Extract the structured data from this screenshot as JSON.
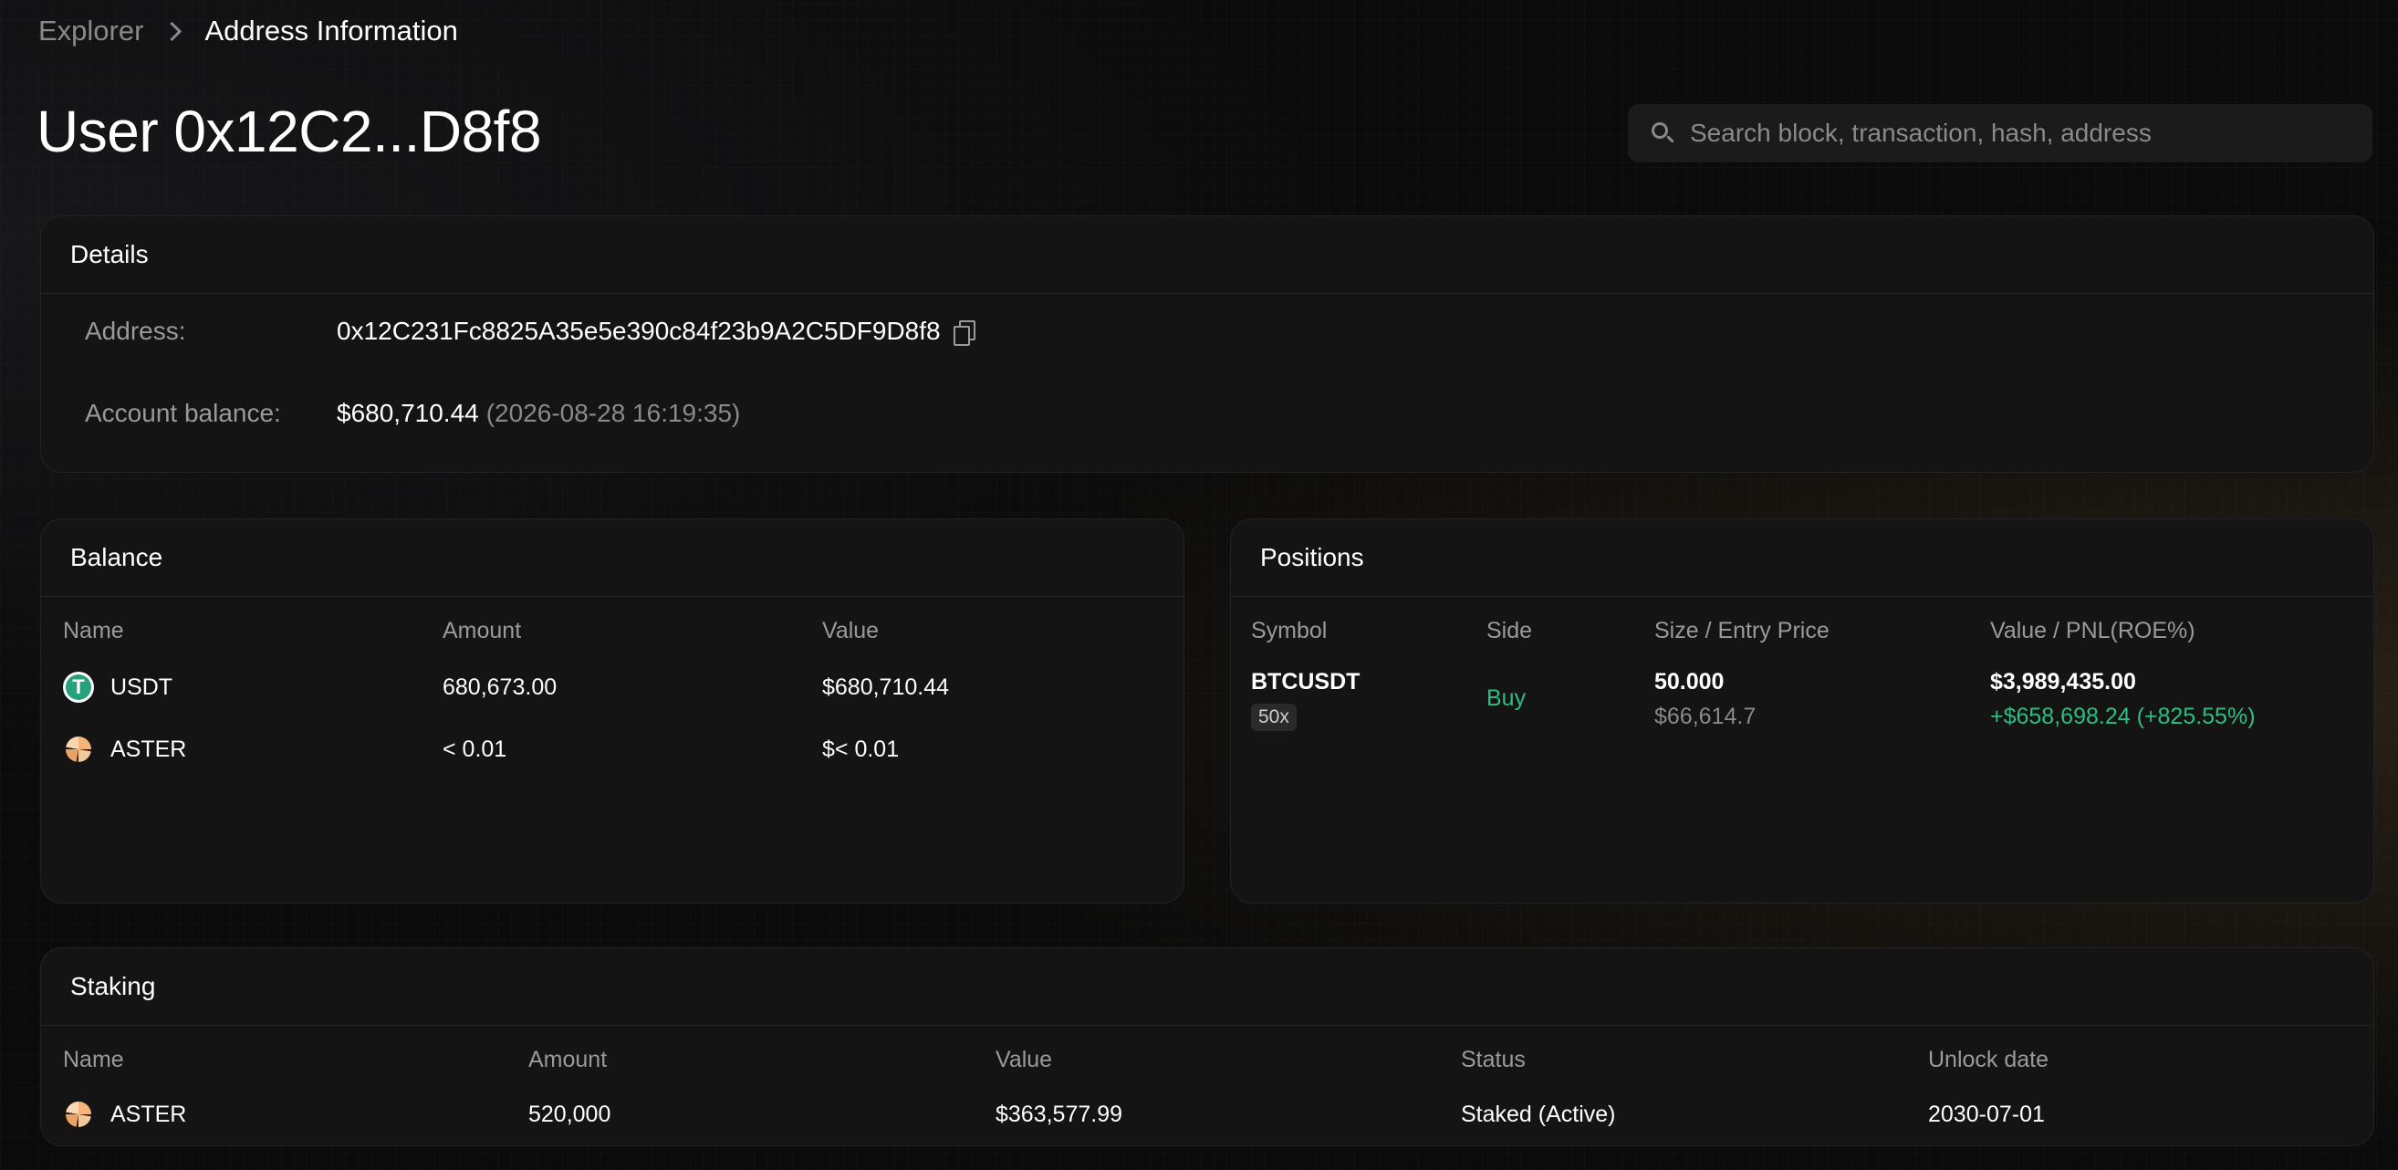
{
  "breadcrumb": {
    "root": "Explorer",
    "current": "Address Information"
  },
  "title": "User 0x12C2...D8f8",
  "search": {
    "placeholder": "Search block, transaction, hash, address",
    "icon": "search-icon"
  },
  "details": {
    "header": "Details",
    "address_label": "Address:",
    "address_value": "0x12C231Fc8825A35e5e390c84f23b9A2C5DF9D8f8",
    "balance_label": "Account balance:",
    "balance_value": "$680,710.44",
    "balance_timestamp": "(2026-08-28 16:19:35)"
  },
  "balance": {
    "header": "Balance",
    "columns": [
      "Name",
      "Amount",
      "Value"
    ],
    "rows": [
      {
        "name": "USDT",
        "amount": "680,673.00",
        "value": "$680,710.44",
        "icon": "usdt-icon"
      },
      {
        "name": "ASTER",
        "amount": "< 0.01",
        "value": "$< 0.01",
        "icon": "aster-icon"
      }
    ]
  },
  "positions": {
    "header": "Positions",
    "columns": [
      "Symbol",
      "Side",
      "Size / Entry Price",
      "Value / PNL(ROE%)"
    ],
    "rows": [
      {
        "symbol": "BTCUSDT",
        "leverage": "50x",
        "side": "Buy",
        "size": "50.000",
        "entry_price": "$66,614.7",
        "value": "$3,989,435.00",
        "pnl": "+$658,698.24 (+825.55%)"
      }
    ]
  },
  "staking": {
    "header": "Staking",
    "columns": [
      "Name",
      "Amount",
      "Value",
      "Status",
      "Unlock date"
    ],
    "rows": [
      {
        "name": "ASTER",
        "amount": "520,000",
        "value": "$363,577.99",
        "status": "Staked (Active)",
        "unlock_date": "2030-07-01",
        "icon": "aster-icon"
      }
    ]
  },
  "colors": {
    "background": "#0b0b0b",
    "card": "#141414",
    "positive": "#2ebd85",
    "muted_text": "#8a8a8a",
    "usdt": "#26a17b"
  }
}
